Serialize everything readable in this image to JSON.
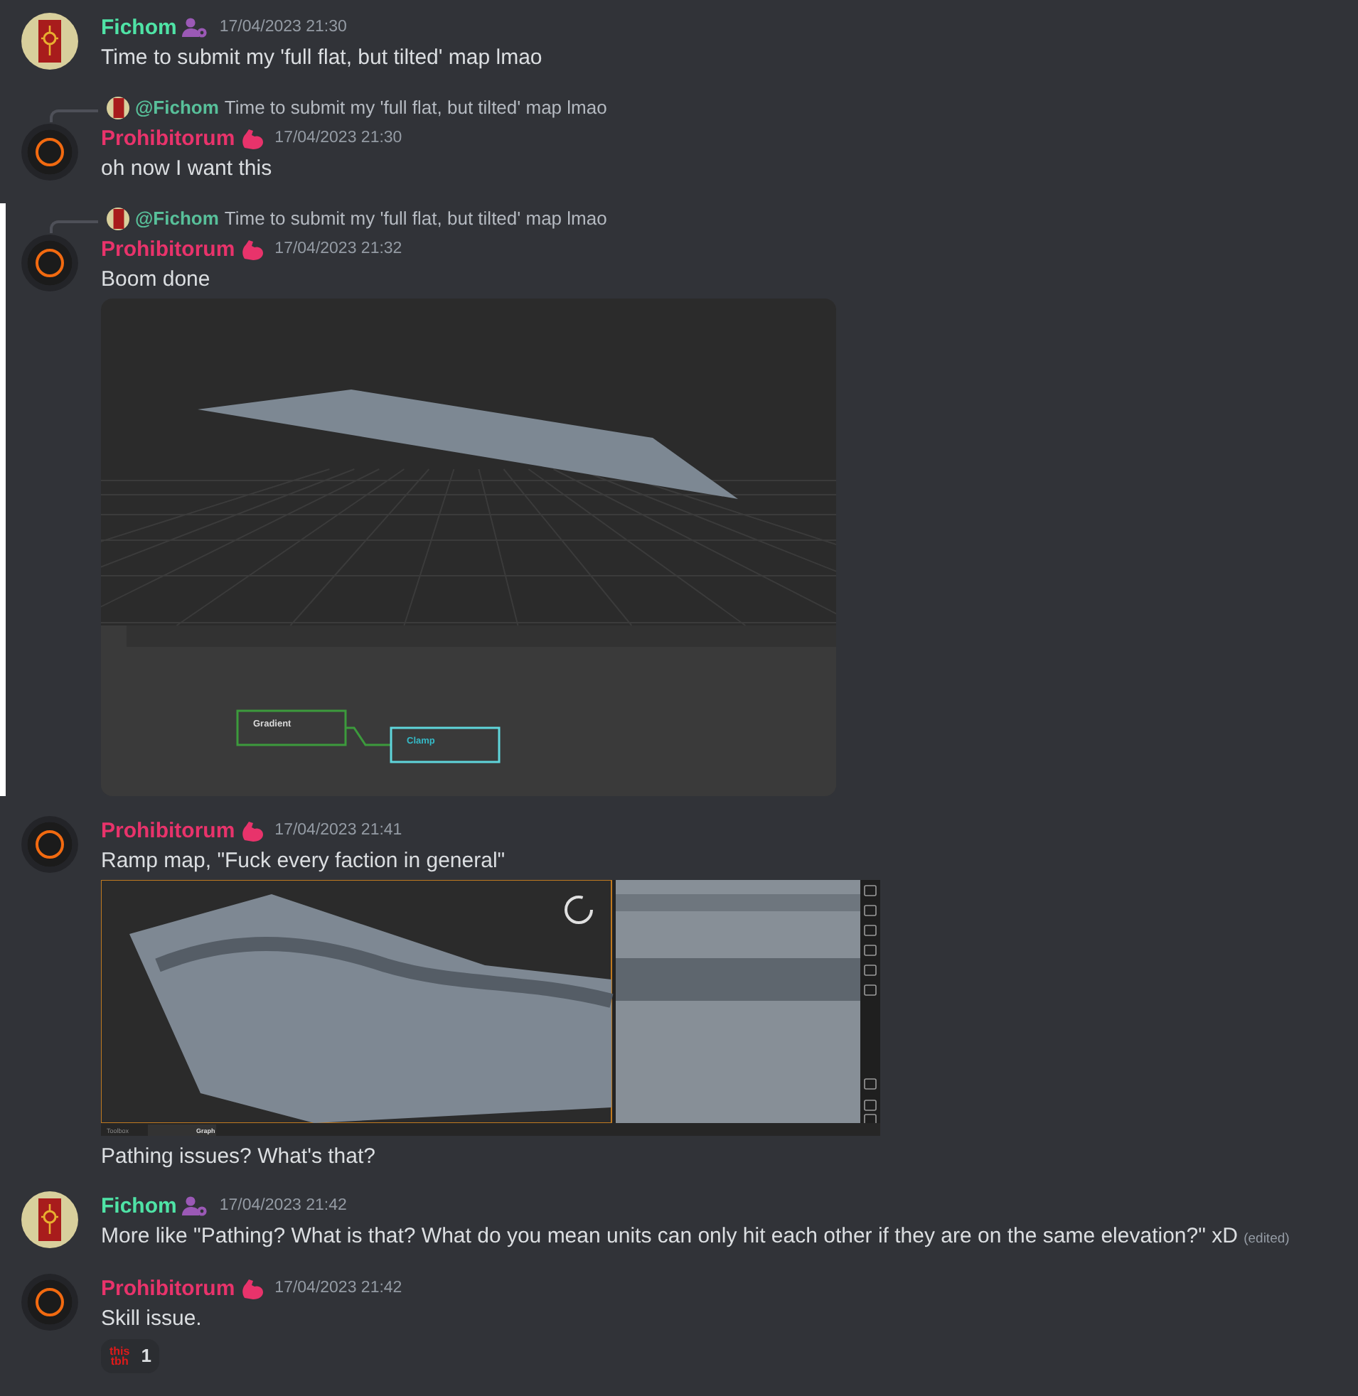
{
  "messages": [
    {
      "author": {
        "name": "Fichom",
        "color": "#4fe3a6",
        "kind": "banner"
      },
      "timestamp": "17/04/2023 21:30",
      "highlighted": false,
      "blocks": [
        {
          "kind": "text",
          "text": "Time to submit my 'full flat, but tilted' map lmao"
        }
      ]
    },
    {
      "author": {
        "name": "Prohibitorum",
        "color": "#e8336b",
        "kind": "ring"
      },
      "timestamp": "17/04/2023 21:30",
      "highlighted": false,
      "reply": {
        "mention": "@Fichom",
        "text": "Time to submit my 'full flat, but tilted' map lmao"
      },
      "blocks": [
        {
          "kind": "text",
          "text": "oh now I want this"
        }
      ]
    },
    {
      "author": {
        "name": "Prohibitorum",
        "color": "#e8336b",
        "kind": "ring"
      },
      "timestamp": "17/04/2023 21:32",
      "highlighted": true,
      "reply": {
        "mention": "@Fichom",
        "text": "Time to submit my 'full flat, but tilted' map lmao"
      },
      "blocks": [
        {
          "kind": "text",
          "text": "Boom done"
        },
        {
          "kind": "graph-render",
          "nodes": [
            "Gradient",
            "Clamp"
          ]
        }
      ]
    },
    {
      "author": {
        "name": "Prohibitorum",
        "color": "#e8336b",
        "kind": "ring"
      },
      "timestamp": "17/04/2023 21:41",
      "highlighted": false,
      "blocks": [
        {
          "kind": "text",
          "text": "Ramp map, \"Fuck every faction in general\""
        },
        {
          "kind": "terrain-render",
          "tabs": [
            "Toolbox",
            "Graph"
          ]
        },
        {
          "kind": "text",
          "text": "Pathing issues? What's that?"
        }
      ]
    },
    {
      "author": {
        "name": "Fichom",
        "color": "#4fe3a6",
        "kind": "banner"
      },
      "timestamp": "17/04/2023 21:42",
      "highlighted": false,
      "blocks": [
        {
          "kind": "text",
          "text": "More like \"Pathing? What is that? What do you mean units can only hit each other if they are on the same elevation?\" xD",
          "edited": "(edited)"
        }
      ]
    },
    {
      "author": {
        "name": "Prohibitorum",
        "color": "#e8336b",
        "kind": "ring"
      },
      "timestamp": "17/04/2023 21:42",
      "highlighted": false,
      "blocks": [
        {
          "kind": "text",
          "text": "Skill issue."
        }
      ],
      "reaction": {
        "emoji": [
          "this",
          "tbh"
        ],
        "count": "1"
      }
    }
  ]
}
